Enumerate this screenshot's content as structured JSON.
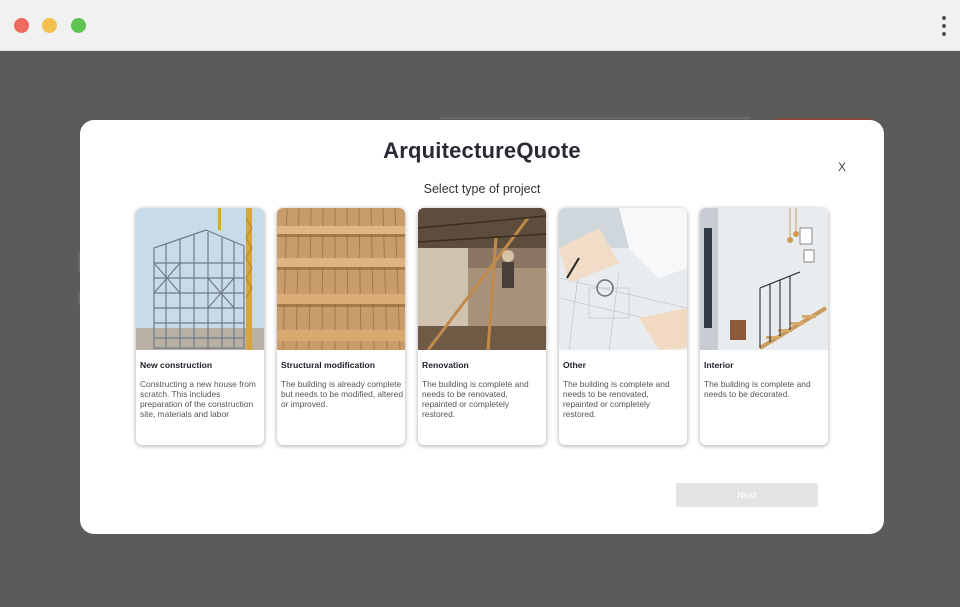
{
  "window": {
    "traffic_lights": [
      "close",
      "minimize",
      "maximize"
    ],
    "menu_icon": "kebab-menu-icon"
  },
  "modal": {
    "title": "ArquitectureQuote",
    "close_label": "X",
    "subtitle": "Select type of project",
    "next_label": "Next",
    "cards": [
      {
        "title": "New construction",
        "description": "Constructing a new house from scratch. This includes preparation of the construction site, materials and labor",
        "image": "steel-frame-building-photo"
      },
      {
        "title": "Structural modification",
        "description": "The building is already complete but needs to be modified, altered or improved.",
        "image": "wooden-beam-ceiling-photo"
      },
      {
        "title": "Renovation",
        "description": "The building is complete and needs to be renovated, repainted or completely restored.",
        "image": "interior-renovation-worker-photo"
      },
      {
        "title": "Other",
        "description": "The building is complete and needs to be renovated, repainted or completely restored.",
        "image": "architect-drawing-plans-photo"
      },
      {
        "title": "Interior",
        "description": "The building is complete and needs to be decorated.",
        "image": "modern-staircase-interior-photo"
      }
    ]
  },
  "colors": {
    "backdrop": "#5b5b5b",
    "title_text": "#2a2a35",
    "next_button_disabled": "#e4e4e4"
  }
}
